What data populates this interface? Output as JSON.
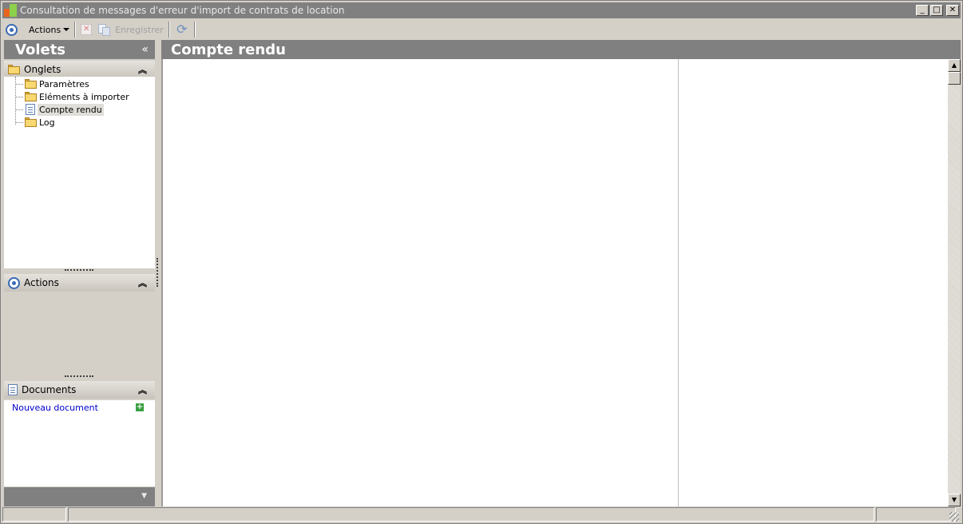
{
  "window": {
    "title": "Consultation de messages d'erreur d'import de contrats de location",
    "controls": {
      "minimize": "_",
      "maximize": "□",
      "close": "✕"
    }
  },
  "toolbar": {
    "actions_label": "Actions",
    "save_label": "Enregistrer",
    "icons": [
      "actions-circle-icon",
      "delete-icon",
      "save-icon",
      "refresh-icon"
    ]
  },
  "left_panel": {
    "title": "Volets",
    "collapse_glyph": "«",
    "tabs_section": {
      "label": "Onglets",
      "chevron": "︽",
      "items": [
        {
          "label": "Paramètres",
          "icon": "folder-icon",
          "selected": false
        },
        {
          "label": "Eléments à importer",
          "icon": "folder-icon",
          "selected": false
        },
        {
          "label": "Compte rendu",
          "icon": "document-icon",
          "selected": true
        },
        {
          "label": "Log",
          "icon": "folder-icon",
          "selected": false
        }
      ]
    },
    "actions_section": {
      "label": "Actions",
      "chevron": "︽"
    },
    "documents_section": {
      "label": "Documents",
      "chevron": "︽",
      "new_document_label": "Nouveau document",
      "new_document_icon": "+"
    },
    "bottom_chevron": "▼"
  },
  "main": {
    "title": "Compte rendu"
  },
  "scrollbar": {
    "up": "▲",
    "down": "▼"
  },
  "colors": {
    "header_bg": "#808080",
    "window_bg": "#d4d0c8",
    "link": "#0000cc"
  }
}
